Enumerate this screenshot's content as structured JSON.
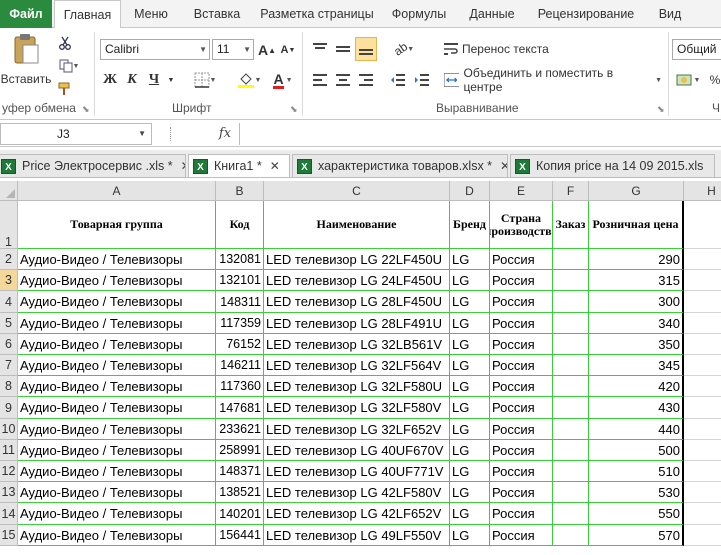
{
  "menu": {
    "tabs": [
      "Файл",
      "Главная",
      "Меню",
      "Вставка",
      "Разметка страницы",
      "Формулы",
      "Данные",
      "Рецензирование",
      "Вид"
    ]
  },
  "ribbon": {
    "clipboard": {
      "paste_label": "Вставить",
      "group_label": "уфер обмена"
    },
    "font": {
      "name": "Calibri",
      "size": "11",
      "bold": "Ж",
      "italic": "К",
      "underline": "Ч",
      "group_label": "Шрифт"
    },
    "alignment": {
      "wrap_text": "Перенос текста",
      "merge_center": "Объединить и поместить в центре",
      "group_label": "Выравнивание"
    },
    "number": {
      "format": "Общий",
      "next_group_partial": "Ч"
    }
  },
  "formula_bar": {
    "name_box": "J3",
    "fx": "fx",
    "value": ""
  },
  "workbooks": [
    {
      "name": "Price Электросервис .xls *"
    },
    {
      "name": "Книга1 *"
    },
    {
      "name": "характеристика товаров.xlsx *"
    },
    {
      "name": "Копия price на 14 09 2015.xls"
    }
  ],
  "sheet": {
    "columns": [
      "A",
      "B",
      "C",
      "D",
      "E",
      "F",
      "G",
      "H"
    ],
    "header_row": {
      "number": "1",
      "cells": [
        "Товарная группа",
        "Код",
        "Наименование",
        "Бренд",
        "Страна производства",
        "Заказ",
        "Розничная цена",
        ""
      ]
    },
    "selected_row": "3",
    "rows": [
      {
        "n": "2",
        "group": "Аудио-Видео / Телевизоры",
        "code": "132081",
        "name": "LED телевизор LG 22LF450U",
        "brand": "LG",
        "country": "Россия",
        "order": "",
        "price": "290"
      },
      {
        "n": "3",
        "group": "Аудио-Видео / Телевизоры",
        "code": "132101",
        "name": "LED телевизор LG 24LF450U",
        "brand": "LG",
        "country": "Россия",
        "order": "",
        "price": "315"
      },
      {
        "n": "4",
        "group": "Аудио-Видео / Телевизоры",
        "code": "148311",
        "name": "LED телевизор LG 28LF450U",
        "brand": "LG",
        "country": "Россия",
        "order": "",
        "price": "300"
      },
      {
        "n": "5",
        "group": "Аудио-Видео / Телевизоры",
        "code": "117359",
        "name": "LED телевизор LG 28LF491U",
        "brand": "LG",
        "country": "Россия",
        "order": "",
        "price": "340"
      },
      {
        "n": "6",
        "group": "Аудио-Видео / Телевизоры",
        "code": "76152",
        "name": "LED телевизор LG 32LB561V",
        "brand": "LG",
        "country": "Россия",
        "order": "",
        "price": "350"
      },
      {
        "n": "7",
        "group": "Аудио-Видео / Телевизоры",
        "code": "146211",
        "name": "LED телевизор LG 32LF564V",
        "brand": "LG",
        "country": "Россия",
        "order": "",
        "price": "345"
      },
      {
        "n": "8",
        "group": "Аудио-Видео / Телевизоры",
        "code": "117360",
        "name": "LED телевизор LG 32LF580U",
        "brand": "LG",
        "country": "Россия",
        "order": "",
        "price": "420"
      },
      {
        "n": "9",
        "group": "Аудио-Видео / Телевизоры",
        "code": "147681",
        "name": "LED телевизор LG 32LF580V",
        "brand": "LG",
        "country": "Россия",
        "order": "",
        "price": "430"
      },
      {
        "n": "10",
        "group": "Аудио-Видео / Телевизоры",
        "code": "233621",
        "name": "LED телевизор LG 32LF652V",
        "brand": "LG",
        "country": "Россия",
        "order": "",
        "price": "440"
      },
      {
        "n": "11",
        "group": "Аудио-Видео / Телевизоры",
        "code": "258991",
        "name": "LED телевизор LG 40UF670V",
        "brand": "LG",
        "country": "Россия",
        "order": "",
        "price": "500"
      },
      {
        "n": "12",
        "group": "Аудио-Видео / Телевизоры",
        "code": "148371",
        "name": "LED телевизор LG 40UF771V",
        "brand": "LG",
        "country": "Россия",
        "order": "",
        "price": "510"
      },
      {
        "n": "13",
        "group": "Аудио-Видео / Телевизоры",
        "code": "138521",
        "name": "LED телевизор LG 42LF580V",
        "brand": "LG",
        "country": "Россия",
        "order": "",
        "price": "530"
      },
      {
        "n": "14",
        "group": "Аудио-Видео / Телевизоры",
        "code": "140201",
        "name": "LED телевизор LG 42LF652V",
        "brand": "LG",
        "country": "Россия",
        "order": "",
        "price": "550"
      },
      {
        "n": "15",
        "group": "Аудио-Видео / Телевизоры",
        "code": "156441",
        "name": "LED телевизор LG 49LF550V",
        "brand": "LG",
        "country": "Россия",
        "order": "",
        "price": "570"
      }
    ]
  }
}
